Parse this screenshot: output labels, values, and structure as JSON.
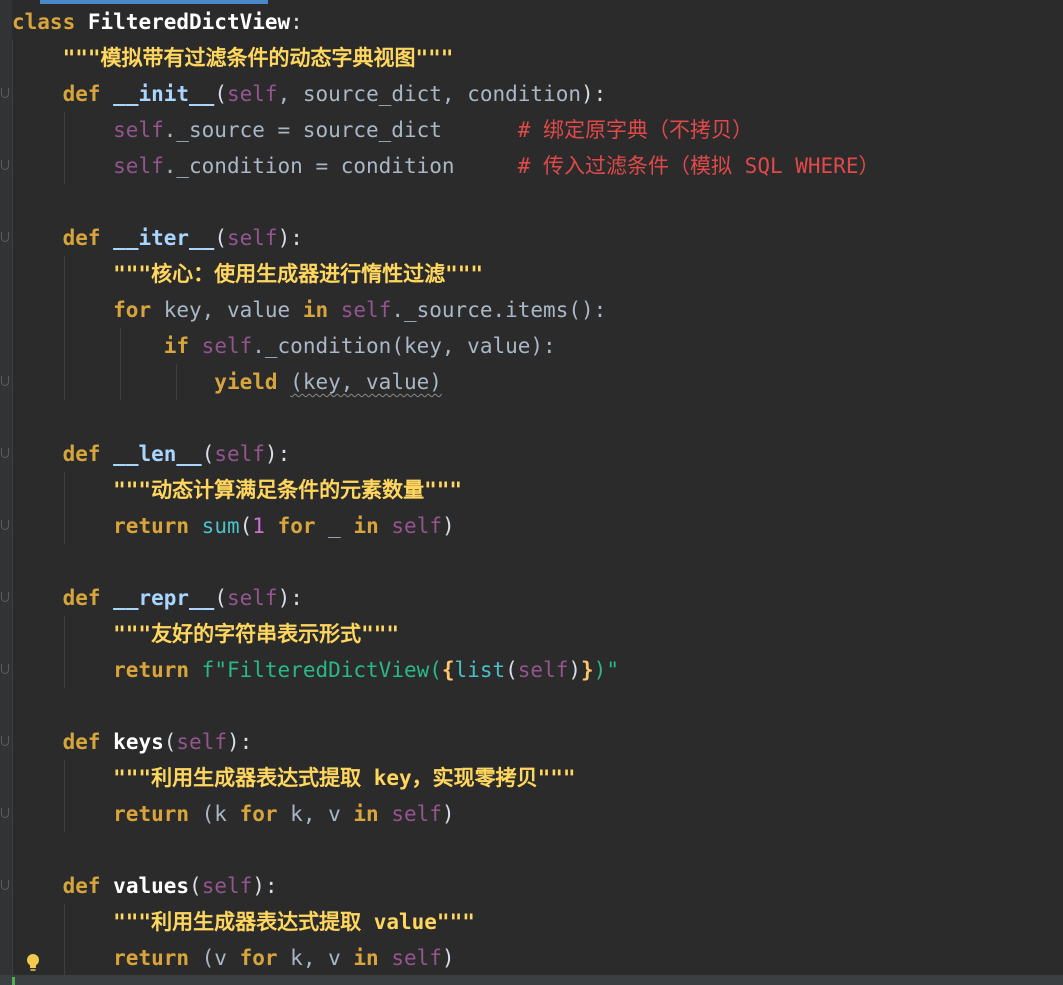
{
  "editor": {
    "accent_color": "#4a88c7",
    "background_color": "#2b2b2b",
    "lines": {
      "l1": {
        "a": "class",
        "b": " ",
        "c": "FilteredDictView",
        "d": ":"
      },
      "l2": {
        "a": "    \"\"\"模拟带有过滤条件的动态字典视图\"\"\""
      },
      "l3": {
        "a": "    ",
        "b": "def",
        "c": " ",
        "d": "__init__",
        "e": "(",
        "f": "self",
        "g": ", source_dict, condition",
        "h": "):"
      },
      "l4": {
        "a": "        ",
        "b": "self",
        "c": "._source = source_dict      ",
        "d": "# 绑定原字典（不拷贝）"
      },
      "l5": {
        "a": "        ",
        "b": "self",
        "c": "._condition = condition     ",
        "d": "# 传入过滤条件（模拟 SQL WHERE）"
      },
      "l7": {
        "a": "    ",
        "b": "def",
        "c": " ",
        "d": "__iter__",
        "e": "(",
        "f": "self",
        "g": "):"
      },
      "l8": {
        "a": "        \"\"\"核心：使用生成器进行惰性过滤\"\"\""
      },
      "l9": {
        "a": "        ",
        "b": "for",
        "c": " key, value ",
        "d": "in",
        "e": " ",
        "f": "self",
        "g": "._source.items():"
      },
      "l10": {
        "a": "            ",
        "b": "if",
        "c": " ",
        "d": "self",
        "e": "._condition(key, value):"
      },
      "l11": {
        "a": "                ",
        "b": "yield",
        "c": " ",
        "d": "(key, value)"
      },
      "l13": {
        "a": "    ",
        "b": "def",
        "c": " ",
        "d": "__len__",
        "e": "(",
        "f": "self",
        "g": "):"
      },
      "l14": {
        "a": "        \"\"\"动态计算满足条件的元素数量\"\"\""
      },
      "l15": {
        "a": "        ",
        "b": "return",
        "c": " ",
        "d": "sum",
        "e": "(",
        "f": "1",
        "g": " ",
        "h": "for",
        "i": " _ ",
        "j": "in",
        "k": " ",
        "l": "self",
        "m": ")"
      },
      "l17": {
        "a": "    ",
        "b": "def",
        "c": " ",
        "d": "__repr__",
        "e": "(",
        "f": "self",
        "g": "):"
      },
      "l18": {
        "a": "        \"\"\"友好的字符串表示形式\"\"\""
      },
      "l19": {
        "a": "        ",
        "b": "return",
        "c": " ",
        "d": "f\"FilteredDictView(",
        "e": "{",
        "f": "list",
        "g": "(",
        "h": "self",
        "i": ")",
        "j": "}",
        "k": ")\""
      },
      "l21": {
        "a": "    ",
        "b": "def",
        "c": " ",
        "d": "keys",
        "e": "(",
        "f": "self",
        "g": "):"
      },
      "l22": {
        "a": "        \"\"\"利用生成器表达式提取 key，实现零拷贝\"\"\""
      },
      "l23": {
        "a": "        ",
        "b": "return",
        "c": " (k ",
        "d": "for",
        "e": " k, v ",
        "f": "in",
        "g": " ",
        "h": "self",
        "i": ")"
      },
      "l25": {
        "a": "    ",
        "b": "def",
        "c": " ",
        "d": "values",
        "e": "(",
        "f": "self",
        "g": "):"
      },
      "l26": {
        "a": "        \"\"\"利用生成器表达式提取 value\"\"\""
      },
      "l27": {
        "a": "        ",
        "b": "return",
        "c": " (v ",
        "d": "for",
        "e": " k, v ",
        "f": "in",
        "g": " ",
        "h": "self",
        "i": ")"
      }
    }
  }
}
